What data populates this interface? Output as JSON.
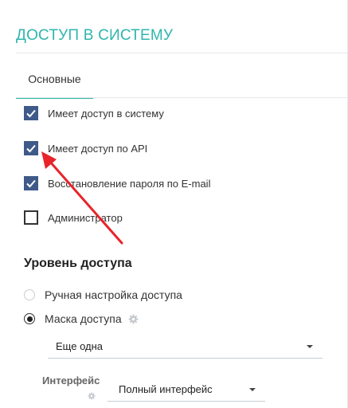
{
  "page": {
    "title": "ДОСТУП В СИСТЕМУ"
  },
  "tabs": [
    {
      "label": "Основные",
      "active": true
    }
  ],
  "checkboxes": [
    {
      "label": "Имеет доступ в систему",
      "checked": true
    },
    {
      "label": "Имеет доступ по API",
      "checked": true
    },
    {
      "label": "Восстановление пароля по E-mail",
      "checked": true
    },
    {
      "label": "Администратор",
      "checked": false
    }
  ],
  "access_level": {
    "title": "Уровень доступа",
    "options": [
      {
        "label": "Ручная настройка доступа",
        "selected": false
      },
      {
        "label": "Маска доступа",
        "selected": true
      }
    ],
    "mask_select_value": "Еще одна",
    "interface_label": "Интерфейс",
    "interface_select_value": "Полный интерфейс"
  },
  "colors": {
    "accent": "#2fb5ae",
    "checkbox": "#3f5a89",
    "annotation_arrow": "#e8242a"
  },
  "icons": [
    "check-icon",
    "gear-icon",
    "caret-down-icon"
  ]
}
